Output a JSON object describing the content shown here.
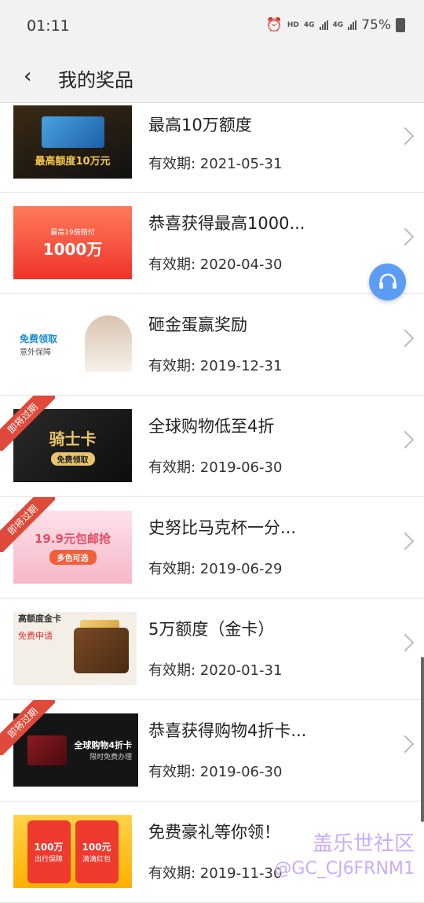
{
  "status": {
    "time": "01:11",
    "hd": "HD",
    "net1": "4G",
    "net2": "4G",
    "battery": "75%"
  },
  "header": {
    "title": "我的奖品"
  },
  "items": [
    {
      "title": "最高10万额度",
      "date": "有效期: 2021-05-31",
      "thumb": "最高额度10万元",
      "expiring": false
    },
    {
      "title": "恭喜获得最高1000...",
      "date": "有效期: 2020-04-30",
      "thumb": "1000万",
      "thumb_sub": "最高19倍赔付",
      "expiring": false
    },
    {
      "title": "砸金蛋赢奖励",
      "date": "有效期: 2019-12-31",
      "thumb": "免费领取",
      "thumb_sub": "意外保障",
      "expiring": false
    },
    {
      "title": "全球购物低至4折",
      "date": "有效期: 2019-06-30",
      "thumb": "骑士卡",
      "thumb_sub": "免费领取",
      "expiring": true
    },
    {
      "title": "史努比马克杯一分...",
      "date": "有效期: 2019-06-29",
      "thumb": "19.9元包邮抢",
      "thumb_sub": "多色可选",
      "expiring": true
    },
    {
      "title": "5万额度（金卡）",
      "date": "有效期: 2020-01-31",
      "thumb": "高额度金卡",
      "thumb_sub": "免费申请",
      "expiring": false
    },
    {
      "title": "恭喜获得购物4折卡...",
      "date": "有效期: 2019-06-30",
      "thumb": "全球购物4折卡",
      "thumb_sub": "限时免费办理",
      "expiring": true
    },
    {
      "title": "免费豪礼等你领！",
      "date": "有效期: 2019-11-30",
      "thumb_left": "100万",
      "thumb_left_sub": "出行保障",
      "thumb_right": "100元",
      "thumb_right_sub": "滴滴红包",
      "expiring": false
    }
  ],
  "ribbon_label": "即将过期",
  "watermark": {
    "line1": "盖乐世社区",
    "line2": "@GC_CJ6FRNM1"
  }
}
